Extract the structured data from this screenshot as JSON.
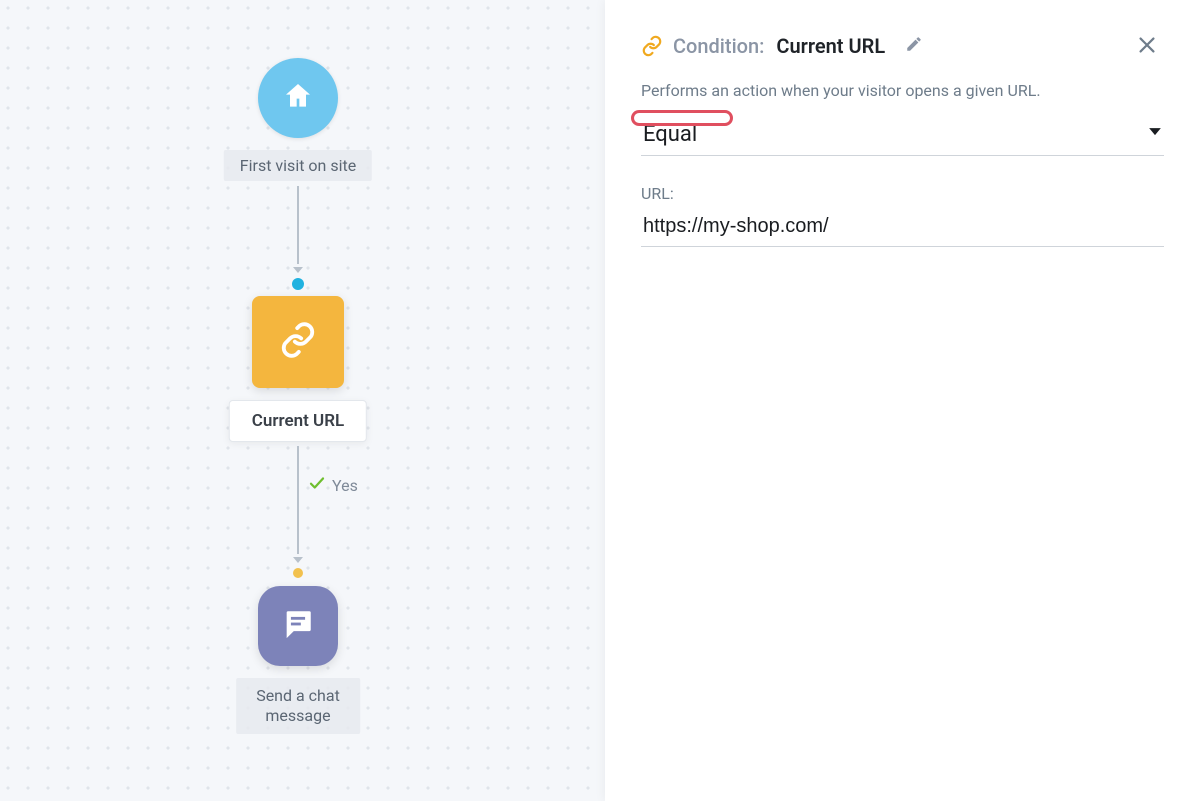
{
  "flow": {
    "start": {
      "label": "First visit on site"
    },
    "condition": {
      "label": "Current URL",
      "yes_label": "Yes"
    },
    "action": {
      "label": "Send a chat\nmessage"
    }
  },
  "panel": {
    "condition_label": "Condition:",
    "condition_value": "Current URL",
    "description": "Performs an action when your visitor opens a given URL.",
    "operator": "Equal",
    "url_label": "URL:",
    "url_value": "https://my-shop.com/"
  }
}
